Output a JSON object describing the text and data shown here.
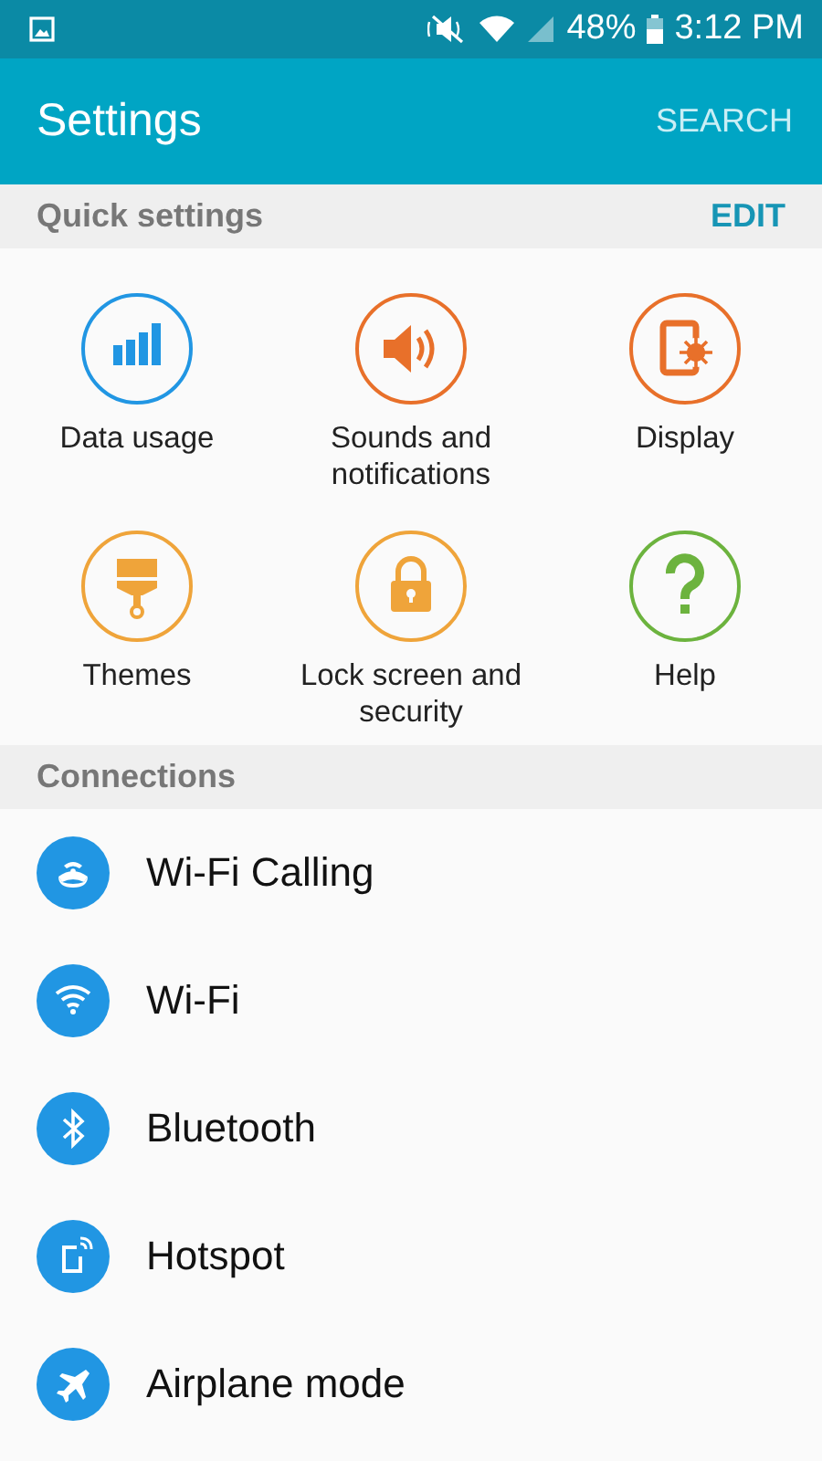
{
  "status_bar": {
    "battery": "48%",
    "time": "3:12 PM"
  },
  "app_bar": {
    "title": "Settings",
    "action": "SEARCH"
  },
  "quick_settings": {
    "title": "Quick settings",
    "action": "EDIT",
    "items": [
      {
        "label": "Data usage",
        "kind": "data",
        "color": "#2196e3"
      },
      {
        "label": "Sounds and notifications",
        "kind": "sound",
        "color": "#e8702a"
      },
      {
        "label": "Display",
        "kind": "display",
        "color": "#e8702a"
      },
      {
        "label": "Themes",
        "kind": "theme",
        "color": "#efa43a"
      },
      {
        "label": "Lock screen and security",
        "kind": "lock",
        "color": "#efa43a"
      },
      {
        "label": "Help",
        "kind": "help",
        "color": "#6cb33e"
      }
    ]
  },
  "connections": {
    "title": "Connections",
    "items": [
      {
        "label": "Wi-Fi Calling",
        "kind": "calling"
      },
      {
        "label": "Wi-Fi",
        "kind": "wifi"
      },
      {
        "label": "Bluetooth",
        "kind": "bluetooth"
      },
      {
        "label": "Hotspot",
        "kind": "hotspot"
      },
      {
        "label": "Airplane mode",
        "kind": "airplane"
      }
    ]
  }
}
